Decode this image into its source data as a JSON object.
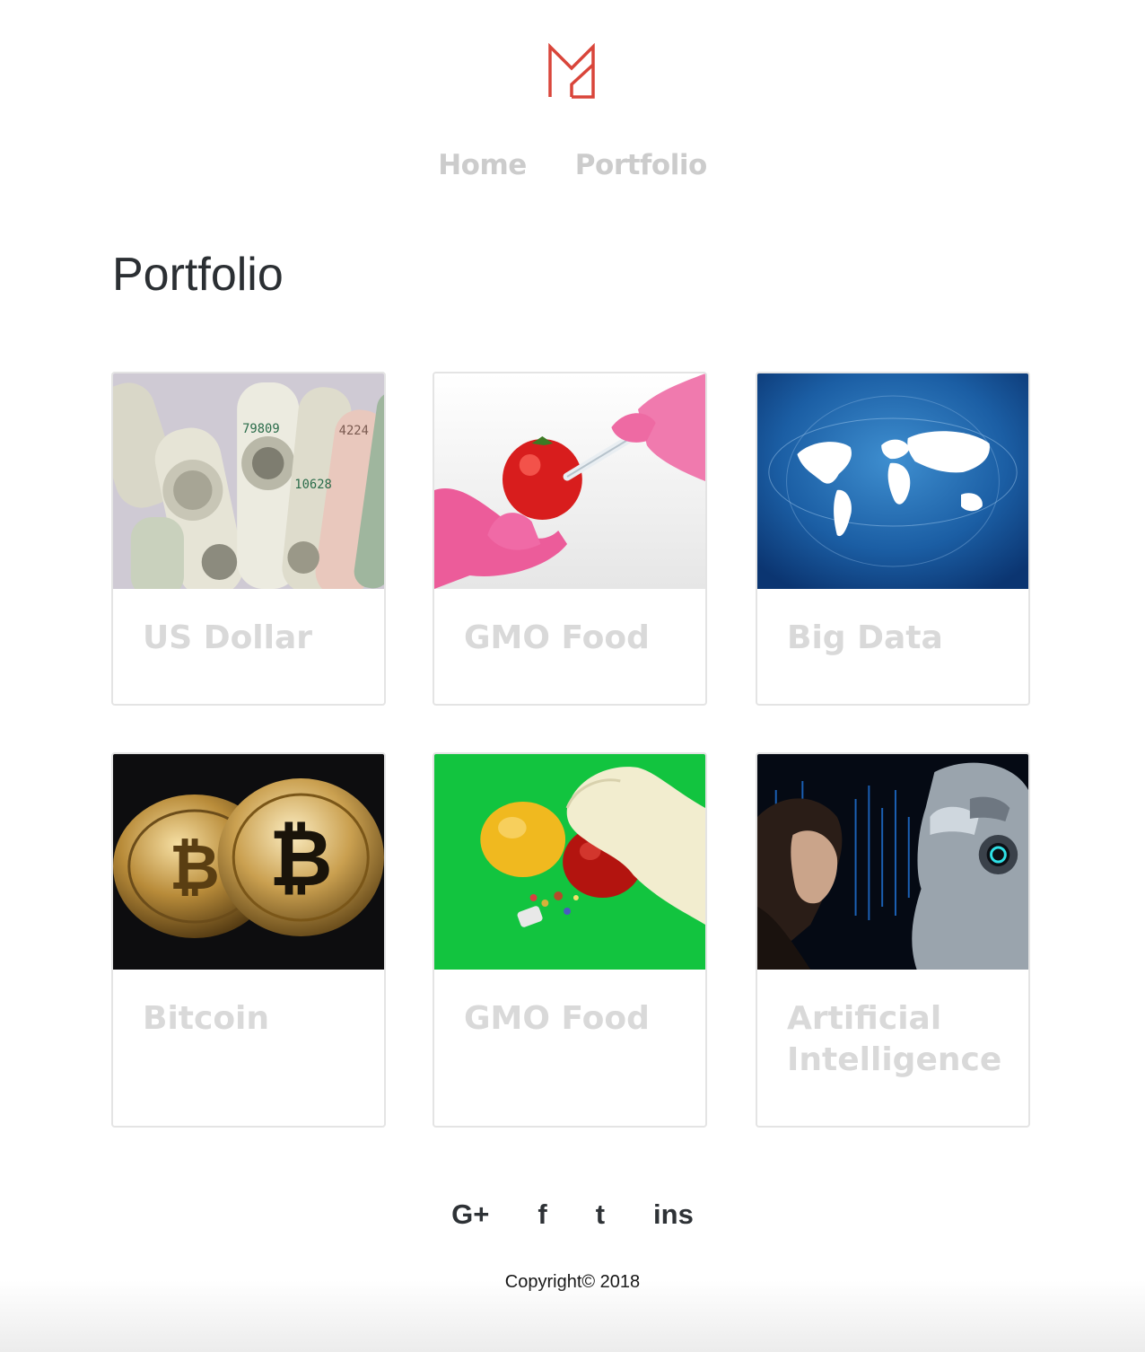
{
  "brand": {
    "logo_icon": "m-monogram-logo",
    "accent_color": "#d9453a"
  },
  "nav": {
    "items": [
      {
        "label": "Home"
      },
      {
        "label": "Portfolio"
      }
    ]
  },
  "main": {
    "title": "Portfolio",
    "cards": [
      {
        "title": "US Dollar",
        "image": "rolled-dollar-bills-photo"
      },
      {
        "title": "GMO Food",
        "image": "tomato-syringe-pink-gloves-photo"
      },
      {
        "title": "Big Data",
        "image": "blue-world-map-network-photo"
      },
      {
        "title": "Bitcoin",
        "image": "gold-bitcoin-coins-photo"
      },
      {
        "title": "GMO Food",
        "image": "bell-pepper-pills-green-photo"
      },
      {
        "title": "Artificial Intelligence",
        "image": "woman-and-robot-face-photo"
      }
    ]
  },
  "footer": {
    "social": [
      {
        "label": "G+",
        "icon": "google-plus-icon"
      },
      {
        "label": "f",
        "icon": "facebook-icon"
      },
      {
        "label": "t",
        "icon": "twitter-icon"
      },
      {
        "label": "ins",
        "icon": "instagram-icon"
      }
    ],
    "copyright": "Copyright© 2018"
  }
}
